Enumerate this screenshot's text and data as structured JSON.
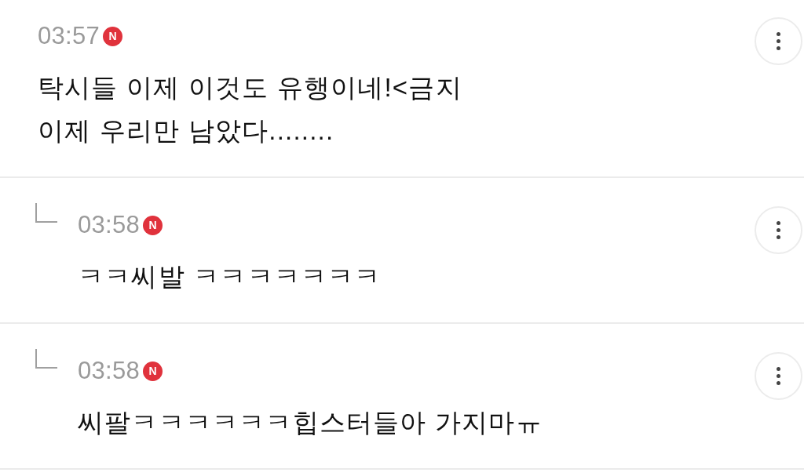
{
  "comments": [
    {
      "kind": "comment",
      "time": "03:57",
      "badge": "N",
      "text": "탁시들 이제 이것도 유행이네!<금지\n이제 우리만 남았다........"
    },
    {
      "kind": "reply",
      "time": "03:58",
      "badge": "N",
      "text": "ㅋㅋ씨발 ㅋㅋㅋㅋㅋㅋㅋ"
    },
    {
      "kind": "reply",
      "time": "03:58",
      "badge": "N",
      "text": "씨팔ㅋㅋㅋㅋㅋㅋ힙스터들아 가지마ㅠ"
    }
  ]
}
